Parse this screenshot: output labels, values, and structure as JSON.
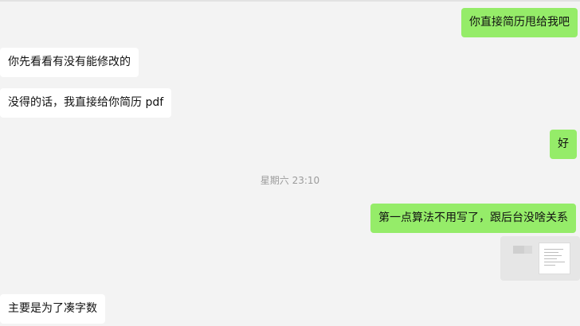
{
  "messages": [
    {
      "direction": "out",
      "text": "你直接简历甩给我吧"
    },
    {
      "direction": "in",
      "text": "你先看看有没有能修改的"
    },
    {
      "direction": "in",
      "text": "没得的话，我直接给你简历 pdf"
    },
    {
      "direction": "out",
      "text": "好"
    },
    {
      "direction": "out",
      "text": "第一点算法不用写了，跟后台没啥关系"
    },
    {
      "direction": "out",
      "type": "file-card"
    },
    {
      "direction": "in",
      "text": "主要是为了凑字数"
    }
  ],
  "timestamp": "星期六 23:10",
  "colors": {
    "outgoing_bubble": "#95ec69",
    "incoming_bubble": "#ffffff",
    "background": "#f3f3f3",
    "timestamp_text": "#9b9b9b"
  }
}
